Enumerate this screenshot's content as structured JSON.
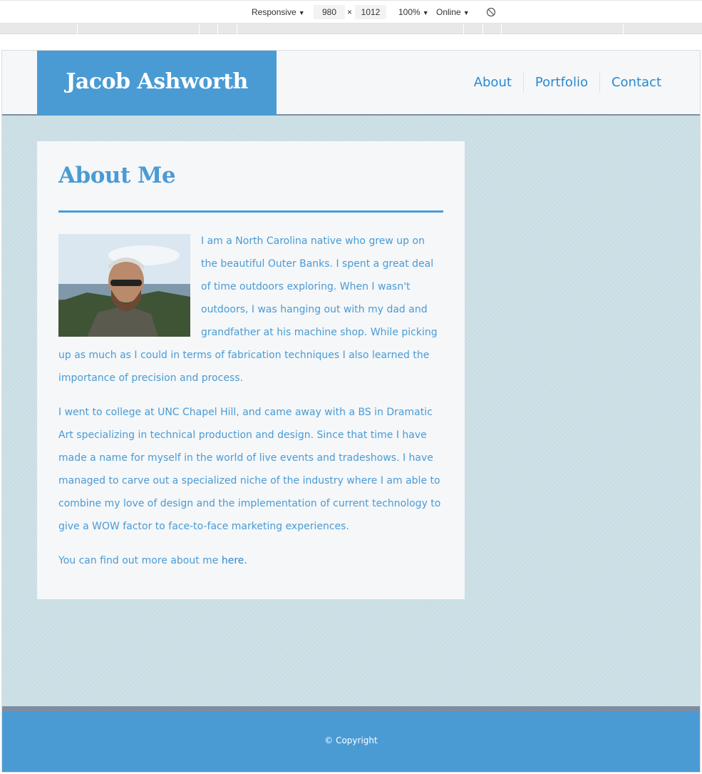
{
  "devtools": {
    "device": "Responsive",
    "width": "980",
    "times": "×",
    "height": "1012",
    "zoom": "100%",
    "network": "Online"
  },
  "site": {
    "title": "Jacob Ashworth",
    "nav": [
      "About",
      "Portfolio",
      "Contact"
    ]
  },
  "about": {
    "heading": "About Me",
    "paragraph1": "I am a North Carolina native who grew up on the beautiful Outer Banks. I spent a great deal of time outdoors exploring. When I wasn't outdoors, I was hanging out with my dad and grandfather at his machine shop. While picking up as much as I could in terms of fabrication techniques I also learned the importance of precision and process.",
    "paragraph2": "I went to college at UNC Chapel Hill, and came away with a BS in Dramatic Art specializing in technical production and design. Since that time I have made a name for myself in the world of live events and tradeshows. I have managed to carve out a specialized niche of the industry where I am able to combine my love of design and the implementation of current technology to give a WOW factor to face-to-face marketing experiences.",
    "paragraph3_prefix": "You can find out more about me ",
    "paragraph3_link": "here."
  },
  "footer": {
    "copyright": "© Copyright"
  },
  "colors": {
    "brand_blue": "#4a9bd4",
    "link_blue": "#2b89cf",
    "page_bg": "#cbdfe5",
    "card_bg": "#f5f7f9",
    "rule_gray": "#7d8ea0"
  }
}
